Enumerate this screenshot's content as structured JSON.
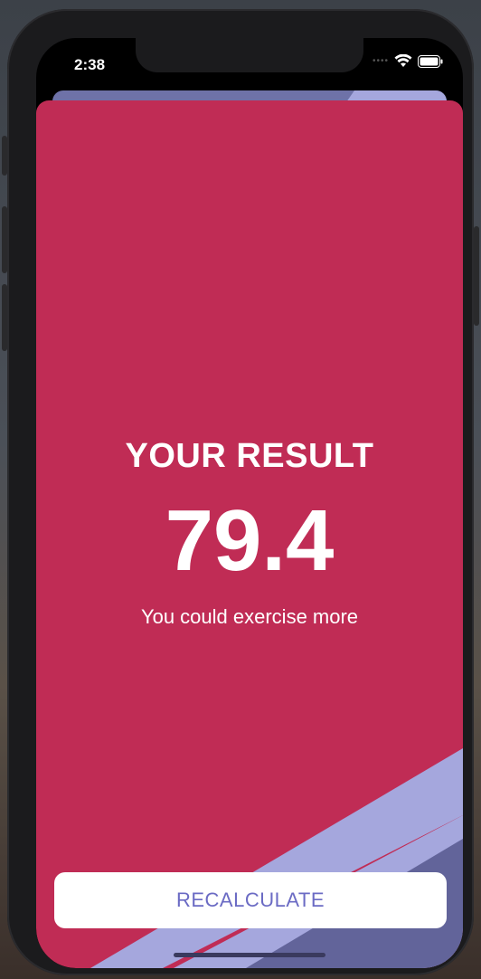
{
  "status_bar": {
    "time": "2:38",
    "signal_icon": "signal-dots-icon",
    "wifi_icon": "wifi-icon",
    "battery_icon": "battery-icon"
  },
  "result_screen": {
    "title": "YOUR RESULT",
    "value": "79.4",
    "message": "You could exercise more",
    "recalculate_label": "RECALCULATE"
  },
  "colors": {
    "background": "#c02c55",
    "accent_light": "#a5a7dd",
    "accent_dark": "#62649a",
    "button_text": "#6b6bc4"
  }
}
